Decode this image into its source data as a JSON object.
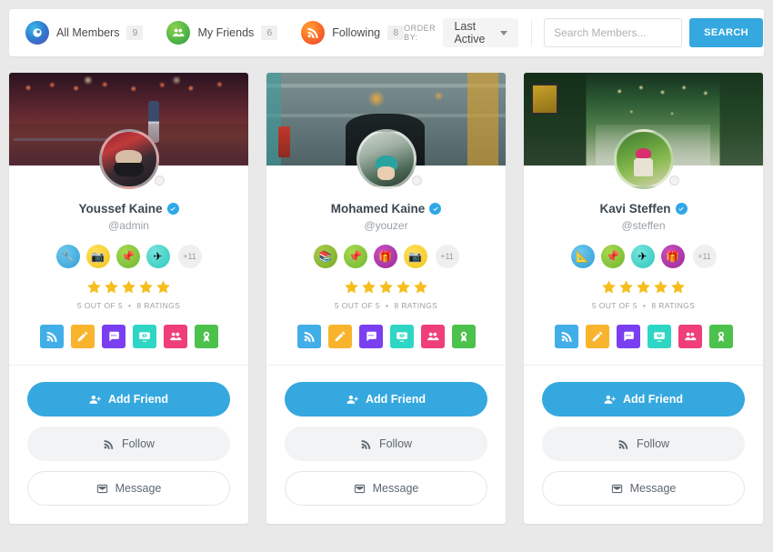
{
  "header": {
    "tabs": [
      {
        "label": "All Members",
        "count": "9",
        "icon": "members-eye-icon",
        "style": "members"
      },
      {
        "label": "My Friends",
        "count": "6",
        "icon": "friends-group-icon",
        "style": "friends"
      },
      {
        "label": "Following",
        "count": "8",
        "icon": "rss-icon",
        "style": "following"
      }
    ],
    "order_by_label": "ORDER BY:",
    "order_by_value": "Last Active",
    "search_placeholder": "Search Members...",
    "search_value": "",
    "search_button": "SEARCH"
  },
  "colors": {
    "accent": "#35a8df",
    "star": "#f5be1e",
    "page_bg": "#e9e9e9",
    "card_bg": "#ffffff",
    "verified": "#2fa8e8"
  },
  "social_tiles": [
    {
      "name": "activity-rss-icon",
      "color": "#41aee8"
    },
    {
      "name": "edit-pencil-icon",
      "color": "#f9b42d"
    },
    {
      "name": "chat-bubble-icon",
      "color": "#7b3ff2"
    },
    {
      "name": "media-monitor-icon",
      "color": "#2ed6c4"
    },
    {
      "name": "friends-group-icon",
      "color": "#ef3e7a"
    },
    {
      "name": "award-badge-icon",
      "color": "#4cc14c"
    }
  ],
  "actions": {
    "add_friend": "Add Friend",
    "follow": "Follow",
    "message": "Message"
  },
  "members": [
    {
      "name": "Youssef Kaine",
      "handle": "@admin",
      "verified": true,
      "stars": 5,
      "rating_text": "5 OUT OF 5",
      "ratings_count_text": "8 RATINGS",
      "badges_more": "+11",
      "badges": [
        {
          "name": "tools-badge",
          "glyph": "🔧",
          "style": "b-blue"
        },
        {
          "name": "camera-badge",
          "glyph": "📷",
          "style": "b-yellow"
        },
        {
          "name": "pushpin-badge",
          "glyph": "📌",
          "style": "b-green"
        },
        {
          "name": "paper-plane-badge",
          "glyph": "✈",
          "style": "b-teal"
        }
      ],
      "cover": "night-street-market-cover",
      "cover_class": "cv1",
      "avatar_class": "av1"
    },
    {
      "name": "Mohamed Kaine",
      "handle": "@youzer",
      "verified": true,
      "stars": 5,
      "rating_text": "5 OUT OF 5",
      "ratings_count_text": "8 RATINGS",
      "badges_more": "+11",
      "badges": [
        {
          "name": "books-badge",
          "glyph": "📚",
          "style": "b-olive"
        },
        {
          "name": "pushpin-badge",
          "glyph": "📌",
          "style": "b-green"
        },
        {
          "name": "gift-badge",
          "glyph": "🎁",
          "style": "b-purple"
        },
        {
          "name": "camera-badge",
          "glyph": "📷",
          "style": "b-yellow"
        }
      ],
      "cover": "graffiti-wall-cover",
      "cover_class": "cv2",
      "avatar_class": "av2"
    },
    {
      "name": "Kavi Steffen",
      "handle": "@steffen",
      "verified": true,
      "stars": 5,
      "rating_text": "5 OUT OF 5",
      "ratings_count_text": "8 RATINGS",
      "badges_more": "+11",
      "badges": [
        {
          "name": "pencil-ruler-badge",
          "glyph": "📐",
          "style": "b-blue"
        },
        {
          "name": "pushpin-badge",
          "glyph": "📌",
          "style": "b-green"
        },
        {
          "name": "paper-plane-badge",
          "glyph": "✈",
          "style": "b-teal"
        },
        {
          "name": "gift-badge",
          "glyph": "🎁",
          "style": "b-purple"
        }
      ],
      "cover": "lantern-street-cover",
      "cover_class": "cv3",
      "avatar_class": "av3"
    }
  ]
}
